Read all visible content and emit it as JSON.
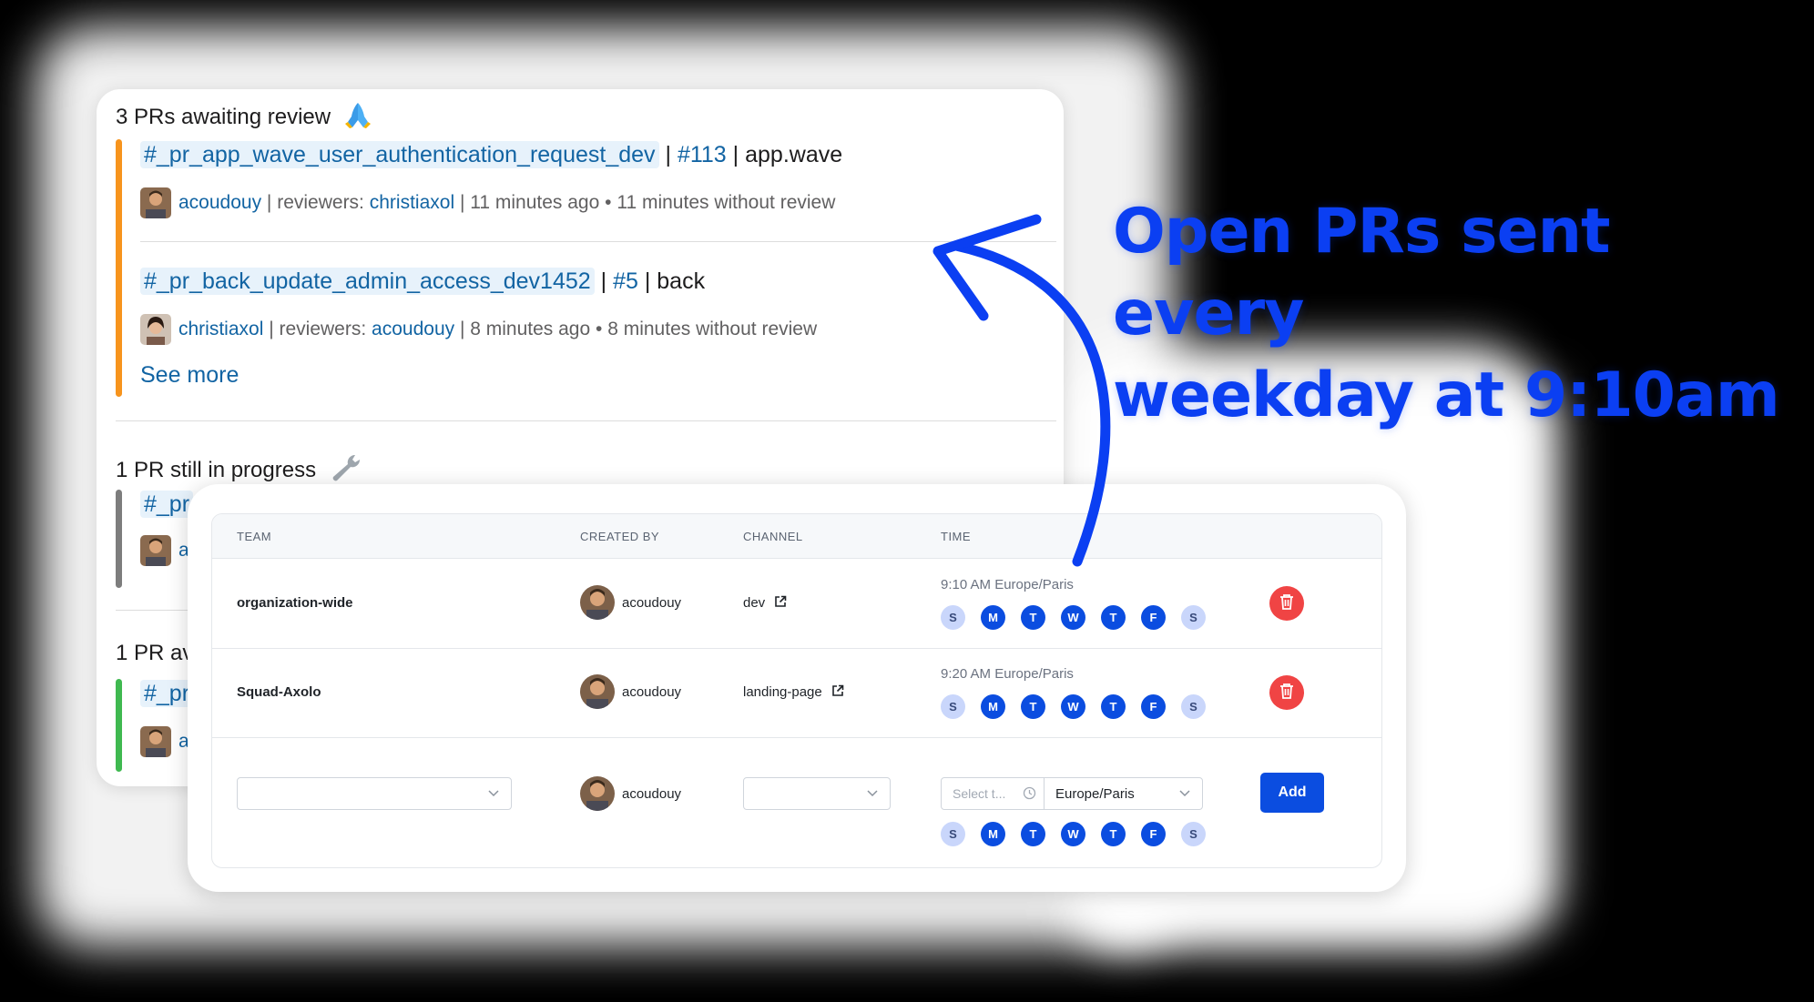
{
  "headline": {
    "line1": "Open PRs sent every",
    "line2": "weekday at 9:10am"
  },
  "slack": {
    "awaiting": {
      "title": "3 PRs awaiting review",
      "emoji": "folded-hands-emoji",
      "items": [
        {
          "channel": "#_pr_app_wave_user_authentication_request_dev",
          "number": "#113",
          "repo": "app.wave",
          "author": "acoudouy",
          "reviewers_label": "reviewers:",
          "reviewer": "christiaxol",
          "age": "11 minutes ago",
          "without_review": "11 minutes without review"
        },
        {
          "channel": "#_pr_back_update_admin_access_dev1452",
          "number": "#5",
          "repo": "back",
          "author": "christiaxol",
          "reviewers_label": "reviewers:",
          "reviewer": "acoudouy",
          "age": "8 minutes ago",
          "without_review": "8 minutes without review"
        }
      ],
      "see_more": "See more"
    },
    "in_progress": {
      "title": "1 PR still in progress",
      "emoji": "wrench-emoji",
      "channel_prefix": "#_pr",
      "author_prefix": "a"
    },
    "third": {
      "title_prefix": "1 PR av",
      "channel_prefix": "#_pr",
      "author_prefix": "a"
    }
  },
  "table": {
    "headers": {
      "team": "TEAM",
      "created_by": "CREATED BY",
      "channel": "CHANNEL",
      "time": "TIME"
    },
    "rows": [
      {
        "team": "organization-wide",
        "created_by": "acoudouy",
        "channel": "dev",
        "time": "9:10 AM Europe/Paris",
        "days": [
          {
            "label": "S",
            "on": false
          },
          {
            "label": "M",
            "on": true
          },
          {
            "label": "T",
            "on": true
          },
          {
            "label": "W",
            "on": true
          },
          {
            "label": "T",
            "on": true
          },
          {
            "label": "F",
            "on": true
          },
          {
            "label": "S",
            "on": false
          }
        ]
      },
      {
        "team": "Squad-Axolo",
        "created_by": "acoudouy",
        "channel": "landing-page",
        "time": "9:20 AM Europe/Paris",
        "days": [
          {
            "label": "S",
            "on": false
          },
          {
            "label": "M",
            "on": true
          },
          {
            "label": "T",
            "on": true
          },
          {
            "label": "W",
            "on": true
          },
          {
            "label": "T",
            "on": true
          },
          {
            "label": "F",
            "on": true
          },
          {
            "label": "S",
            "on": false
          }
        ]
      }
    ],
    "new_row": {
      "team_value": "",
      "created_by": "acoudouy",
      "channel_value": "",
      "time_placeholder": "Select t...",
      "timezone": "Europe/Paris",
      "add_label": "Add",
      "days": [
        {
          "label": "S",
          "on": false
        },
        {
          "label": "M",
          "on": true
        },
        {
          "label": "T",
          "on": true
        },
        {
          "label": "W",
          "on": true
        },
        {
          "label": "T",
          "on": true
        },
        {
          "label": "F",
          "on": true
        },
        {
          "label": "S",
          "on": false
        }
      ]
    }
  },
  "colors": {
    "accent_blue": "#0b4de0",
    "headline_blue": "#0b3ff2",
    "slack_link": "#1264a3",
    "delete_red": "#f04444",
    "bar_orange": "#f7941d",
    "bar_grey": "#7d7d7d",
    "bar_green": "#3fb950"
  }
}
